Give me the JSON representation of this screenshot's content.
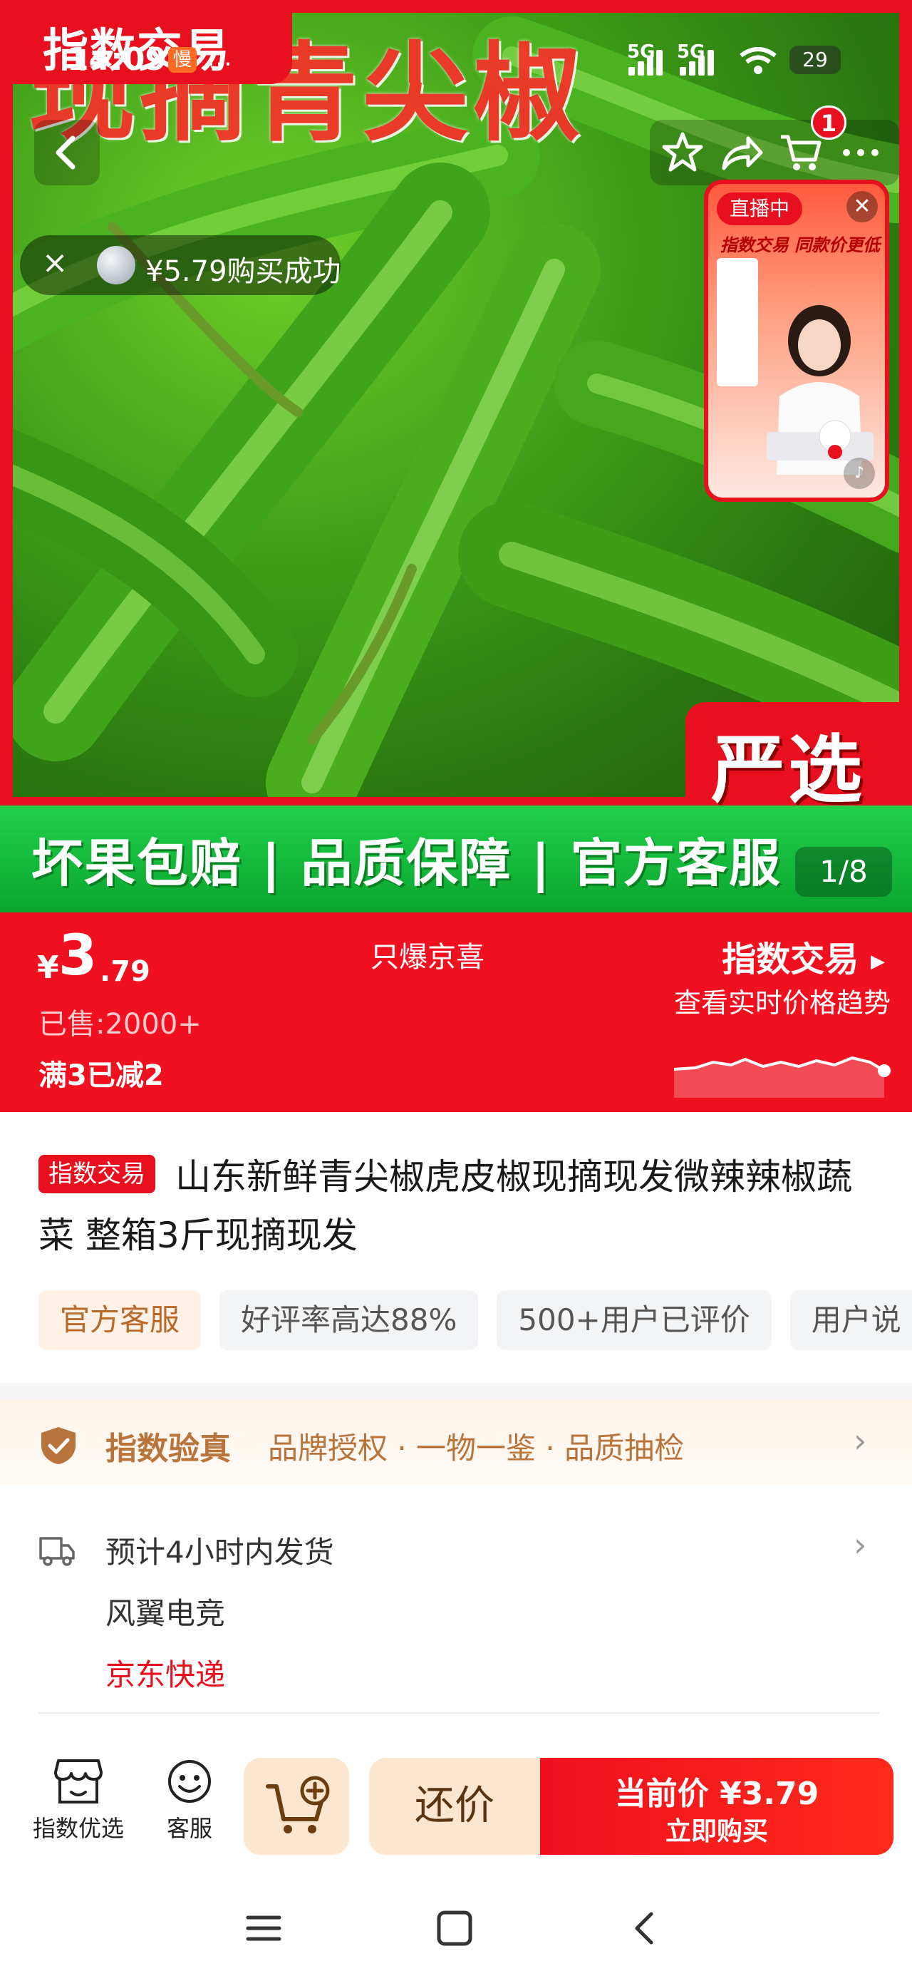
{
  "status_bar": {
    "time": "14:09",
    "slow_badge": "慢",
    "dots": "…",
    "sim1": "5G",
    "sim2": "5G",
    "battery": "29"
  },
  "hero": {
    "big_text": "现摘青尖椒",
    "brand_tab": "指数交易",
    "banner_text": "坏果包赔 | 品质保障 | 官方客服",
    "badge": "严选",
    "image_counter": "1/8",
    "cart_count": "1"
  },
  "toast": {
    "close": "×",
    "text": "¥5.79购买成功"
  },
  "live": {
    "tag": "直播中",
    "close": "✕",
    "slogan": "指数交易 同款价更低"
  },
  "price": {
    "currency": "¥",
    "integer": "3",
    "decimal": ".79",
    "sold": "已售:2000+",
    "promo": "满3已减2",
    "middle_label": "只爆京喜",
    "index_title": "指数交易",
    "index_subtitle": "查看实时价格趋势"
  },
  "product": {
    "tag": "指数交易",
    "title": "山东新鲜青尖椒虎皮椒现摘现发微辣辣椒蔬菜 整箱3斤现摘现发",
    "chips": [
      "官方客服",
      "好评率高达88%",
      "500+用户已评价",
      "用户说"
    ]
  },
  "verify": {
    "label": "指数验真",
    "desc": "品牌授权 · 一物一鉴 · 品质抽检"
  },
  "delivery": {
    "line1": "预计4小时内发货",
    "line2": "风翼电竞",
    "line3": "京东快递"
  },
  "actions": {
    "store_label": "指数优选",
    "service_label": "客服",
    "bargain_label": "还价",
    "buy_price": "当前价 ¥3.79",
    "buy_label": "立即购买"
  },
  "colors": {
    "brand_red": "#e8101e",
    "banner_green": "#12b83a",
    "verify_brown": "#b8743a",
    "soft_orange": "#fde6cf"
  }
}
